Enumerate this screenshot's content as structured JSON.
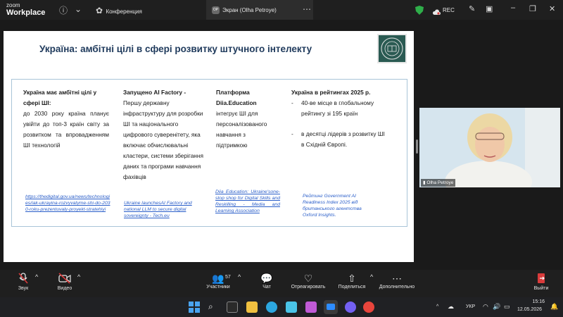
{
  "app": {
    "logo_top": "zoom",
    "logo_bottom": "Workplace"
  },
  "tabs": [
    {
      "label": "Конференция"
    },
    {
      "label": "Экран (Olha Petroye)",
      "badge": "OP"
    }
  ],
  "topbar": {
    "rec_label": "REC"
  },
  "slide": {
    "title": "Україна: амбітні цілі в сфері розвитку штучного інтелекту",
    "col1": {
      "heading": "Україна має амбітні цілі у сфері ШІ:",
      "body": "до 2030 року країна планує увійти до топ-3 країн світу за розвитком та впровадженням ШІ технологій",
      "link": "https://thedigital.gov.ua/news/technologies/iak-ukrayina-rozvyvatyme-shi-do-2030-roku-prezentuvaly-proyekt-stratehiyi"
    },
    "col2": {
      "heading": "Запущено AI Factory -",
      "body": "Першу державну інфраструктуру для розробки ШІ та національного цифрового суверенітету, яка включає обчислювальні кластери, системи зберігання даних та програми навчання фахівців",
      "link": "Ukraine launchesAI Factory and national LLM to secure digital sovereignty - Tech.eu"
    },
    "col3": {
      "heading": "Платформа Diia.Education",
      "body": "інтегрує ШІ для персоналізованого навчання з підтримкою",
      "link": "Diia Education: Ukraine'sone- stop shop for Digital Skills and Reskilling - Media and Learning Association"
    },
    "col4": {
      "heading": "Україна в рейтингах 2025 р.",
      "bullets": [
        "40-ве місце в глобальному рейтингу зі 195 країн",
        "в десятці лідерів з розвитку ШІ в Східній Європі."
      ],
      "source": "Рейтинг Government AI Readiness Index 2025 від британського агентства Oxford Insights."
    }
  },
  "video": {
    "name": "Olha Petroye"
  },
  "toolbar": {
    "audio": "Звук",
    "video": "Видео",
    "participants": "Участники",
    "participants_count": "57",
    "chat": "Чат",
    "react": "Отреагировать",
    "share": "Поделиться",
    "more": "Дополнительно",
    "leave": "Выйти"
  },
  "taskbar": {
    "lang": "УКР",
    "time": "15:16",
    "date": "12.05.2026"
  },
  "colors": {
    "accent": "#1f3a5c",
    "leave": "#d93b3b",
    "security": "#2fae4a"
  }
}
